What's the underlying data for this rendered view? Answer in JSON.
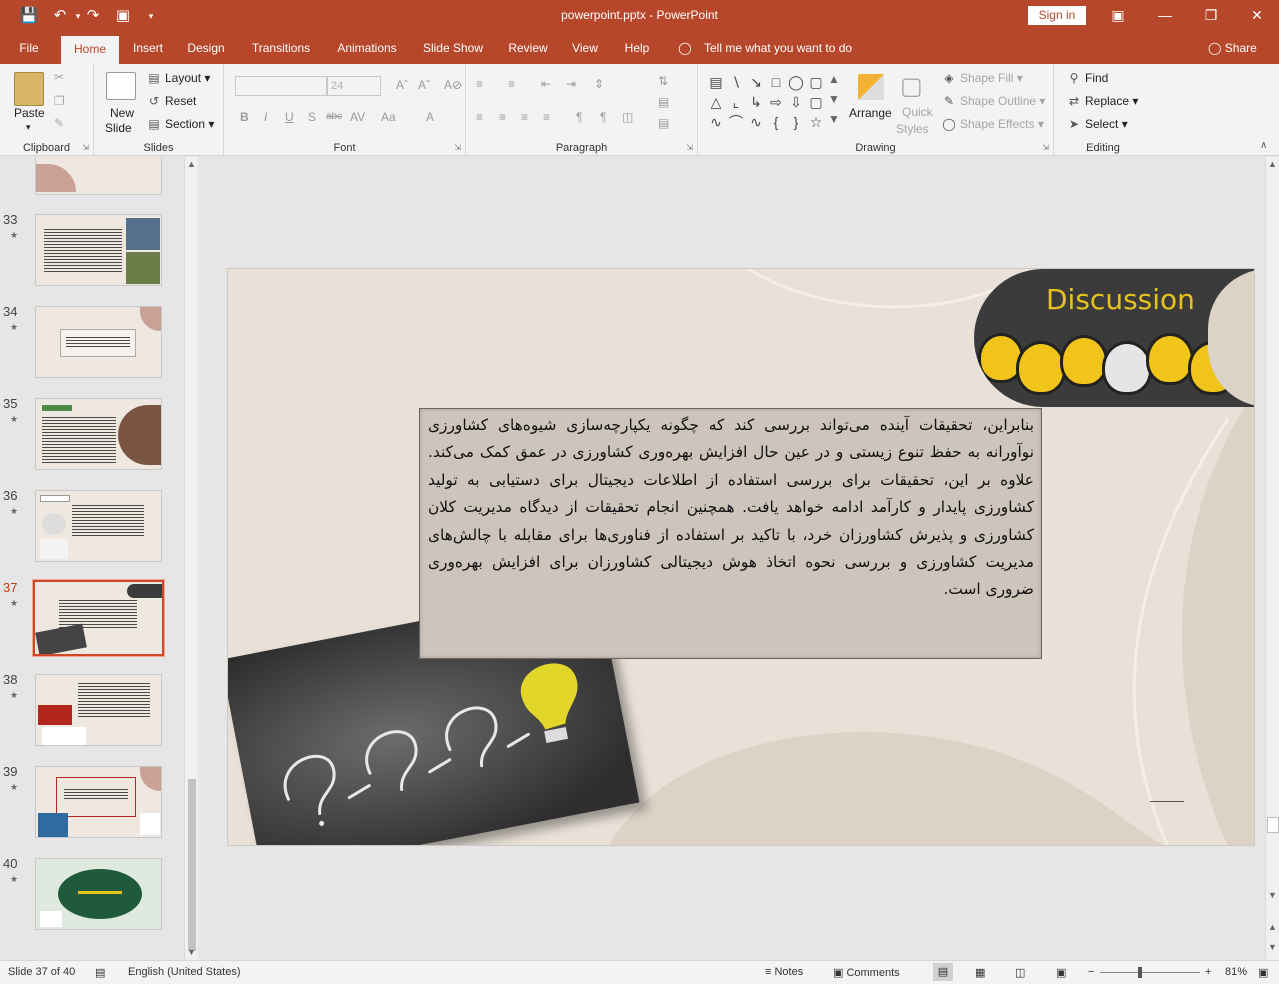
{
  "window": {
    "title": "powerpoint.pptx  -  PowerPoint",
    "sign_in": "Sign in"
  },
  "tabs": [
    "File",
    "Home",
    "Insert",
    "Design",
    "Transitions",
    "Animations",
    "Slide Show",
    "Review",
    "View",
    "Help"
  ],
  "active_tab": "Home",
  "tell_me": "Tell me what you want to do",
  "share": "Share",
  "ribbon": {
    "clipboard": {
      "label": "Clipboard",
      "paste": "Paste"
    },
    "slides": {
      "label": "Slides",
      "new_slide_1": "New",
      "new_slide_2": "Slide",
      "layout": "Layout",
      "reset": "Reset",
      "section": "Section"
    },
    "font": {
      "label": "Font",
      "size": "24"
    },
    "paragraph": {
      "label": "Paragraph"
    },
    "drawing": {
      "label": "Drawing",
      "arrange": "Arrange",
      "quick_styles_1": "Quick",
      "quick_styles_2": "Styles",
      "shape_fill": "Shape Fill",
      "shape_outline": "Shape Outline",
      "shape_effects": "Shape Effects"
    },
    "editing": {
      "label": "Editing",
      "find": "Find",
      "replace": "Replace",
      "select": "Select"
    }
  },
  "thumbnails": [
    {
      "num": "33"
    },
    {
      "num": "34"
    },
    {
      "num": "35"
    },
    {
      "num": "36"
    },
    {
      "num": "37"
    },
    {
      "num": "38"
    },
    {
      "num": "39"
    },
    {
      "num": "40"
    }
  ],
  "selected_slide": "37",
  "slide": {
    "title": "Discussion",
    "body": "بنابراین، تحقیقات آینده می‌تواند بررسی کند که چگونه یکپارچه‌سازی شیوه‌های کشاورزی نوآورانه به حفظ تنوع زیستی و در عین حال افزایش بهره‌وری کشاورزی در عمق کمک می‌کند. علاوه بر این، تحقیقات برای بررسی استفاده از اطلاعات دیجیتال برای دستیابی به تولید کشاورزی پایدار و کارآمد ادامه خواهد یافت. همچنین انجام تحقیقات از دیدگاه مدیریت کلان کشاورزی و پذیرش کشاورزان خرد، با تاکید بر استفاده از فناوری‌ها برای مقابله با چالش‌های مدیریت کشاورزی و بررسی نحوه اتخاذ هوش دیجیتالی کشاورزان برای افزایش بهره‌وری ضروری است."
  },
  "status": {
    "slide_info": "Slide 37 of 40",
    "language": "English (United States)",
    "notes": "Notes",
    "comments": "Comments",
    "zoom": "81%"
  },
  "colors": {
    "accent": "#b7472a",
    "slide_bg": "#e9e1d8",
    "title": "#e8c21c"
  }
}
